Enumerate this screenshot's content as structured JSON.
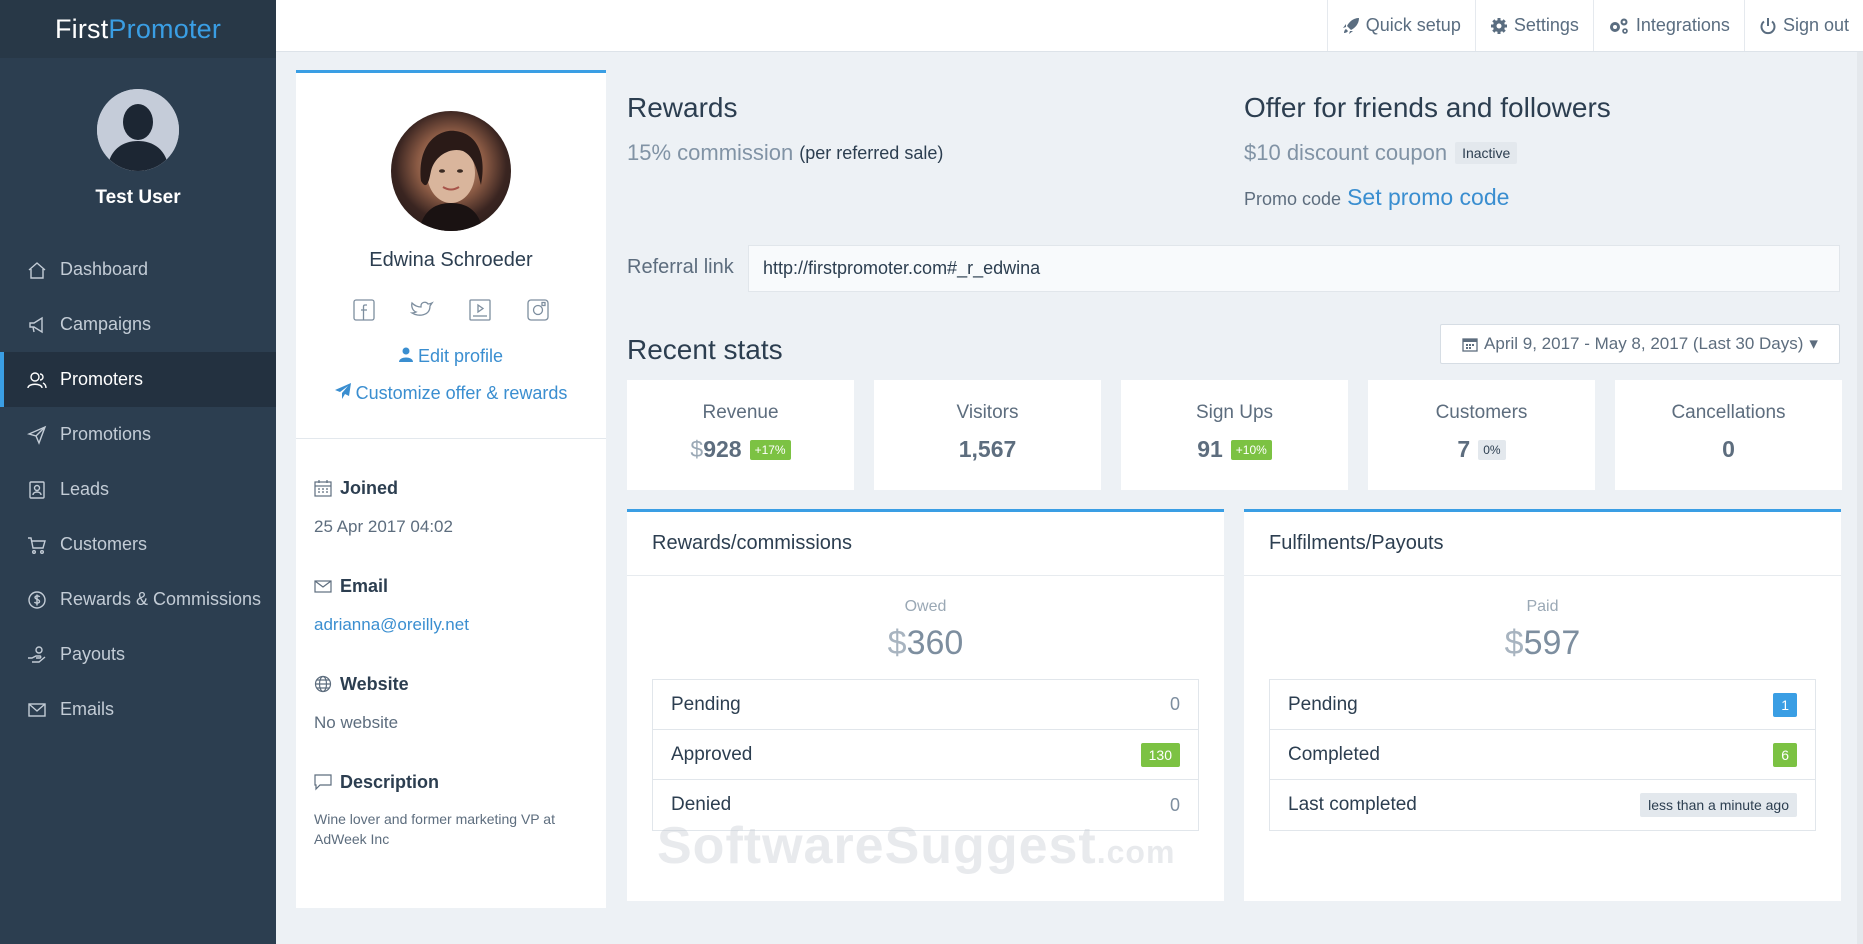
{
  "brand": {
    "part1": "First",
    "part2": "Promoter"
  },
  "user": {
    "name": "Test User"
  },
  "nav": [
    {
      "label": "Dashboard",
      "icon": "home-icon"
    },
    {
      "label": "Campaigns",
      "icon": "megaphone-icon"
    },
    {
      "label": "Promoters",
      "icon": "users-icon",
      "active": true
    },
    {
      "label": "Promotions",
      "icon": "paper-plane-icon"
    },
    {
      "label": "Leads",
      "icon": "contact-card-icon"
    },
    {
      "label": "Customers",
      "icon": "cart-icon"
    },
    {
      "label": "Rewards & Commissions",
      "icon": "dollar-circle-icon"
    },
    {
      "label": "Payouts",
      "icon": "hand-coin-icon"
    },
    {
      "label": "Emails",
      "icon": "envelope-icon"
    }
  ],
  "topbar": {
    "quick_setup": "Quick setup",
    "settings": "Settings",
    "integrations": "Integrations",
    "sign_out": "Sign out"
  },
  "profile": {
    "name": "Edwina Schroeder",
    "edit_profile": "Edit profile",
    "customize": "Customize offer & rewards",
    "joined_label": "Joined",
    "joined_value": "25 Apr 2017 04:02",
    "email_label": "Email",
    "email_value": "adrianna@oreilly.net",
    "website_label": "Website",
    "website_value": "No website",
    "description_label": "Description",
    "description_value": "Wine lover and former marketing VP at AdWeek Inc"
  },
  "rewards": {
    "title": "Rewards",
    "commission": "15% commission",
    "commission_note": "(per referred sale)"
  },
  "offer": {
    "title": "Offer for friends and followers",
    "discount": "$10 discount coupon",
    "status": "Inactive",
    "promo_label": "Promo code",
    "promo_link": "Set promo code"
  },
  "referral": {
    "label": "Referral link",
    "value": "http://firstpromoter.com#_r_edwina"
  },
  "stats": {
    "title": "Recent stats",
    "date_range": "April 9, 2017 - May 8, 2017 (Last 30 Days)",
    "revenue": {
      "label": "Revenue",
      "currency": "$",
      "value": "928",
      "change": "+17%"
    },
    "visitors": {
      "label": "Visitors",
      "value": "1,567"
    },
    "signups": {
      "label": "Sign Ups",
      "value": "91",
      "change": "+10%"
    },
    "customers": {
      "label": "Customers",
      "value": "7",
      "change": "0%"
    },
    "cancellations": {
      "label": "Cancellations",
      "value": "0"
    }
  },
  "commissions": {
    "title": "Rewards/commissions",
    "mini": "Owed",
    "currency": "$",
    "amount": "360",
    "rows": [
      {
        "label": "Pending",
        "value": "0"
      },
      {
        "label": "Approved",
        "value": "130"
      },
      {
        "label": "Denied",
        "value": "0"
      }
    ]
  },
  "payouts": {
    "title": "Fulfilments/Payouts",
    "mini": "Paid",
    "currency": "$",
    "amount": "597",
    "rows": [
      {
        "label": "Pending",
        "value": "1"
      },
      {
        "label": "Completed",
        "value": "6"
      },
      {
        "label": "Last completed",
        "value": "less than a minute ago"
      }
    ]
  },
  "watermark": {
    "main": "SoftwareSuggest",
    "suffix": ".com"
  },
  "colors": {
    "sidebar": "#2c3e50",
    "accent": "#3a9ee4",
    "green": "#7cc243",
    "background": "#edf1f5"
  }
}
